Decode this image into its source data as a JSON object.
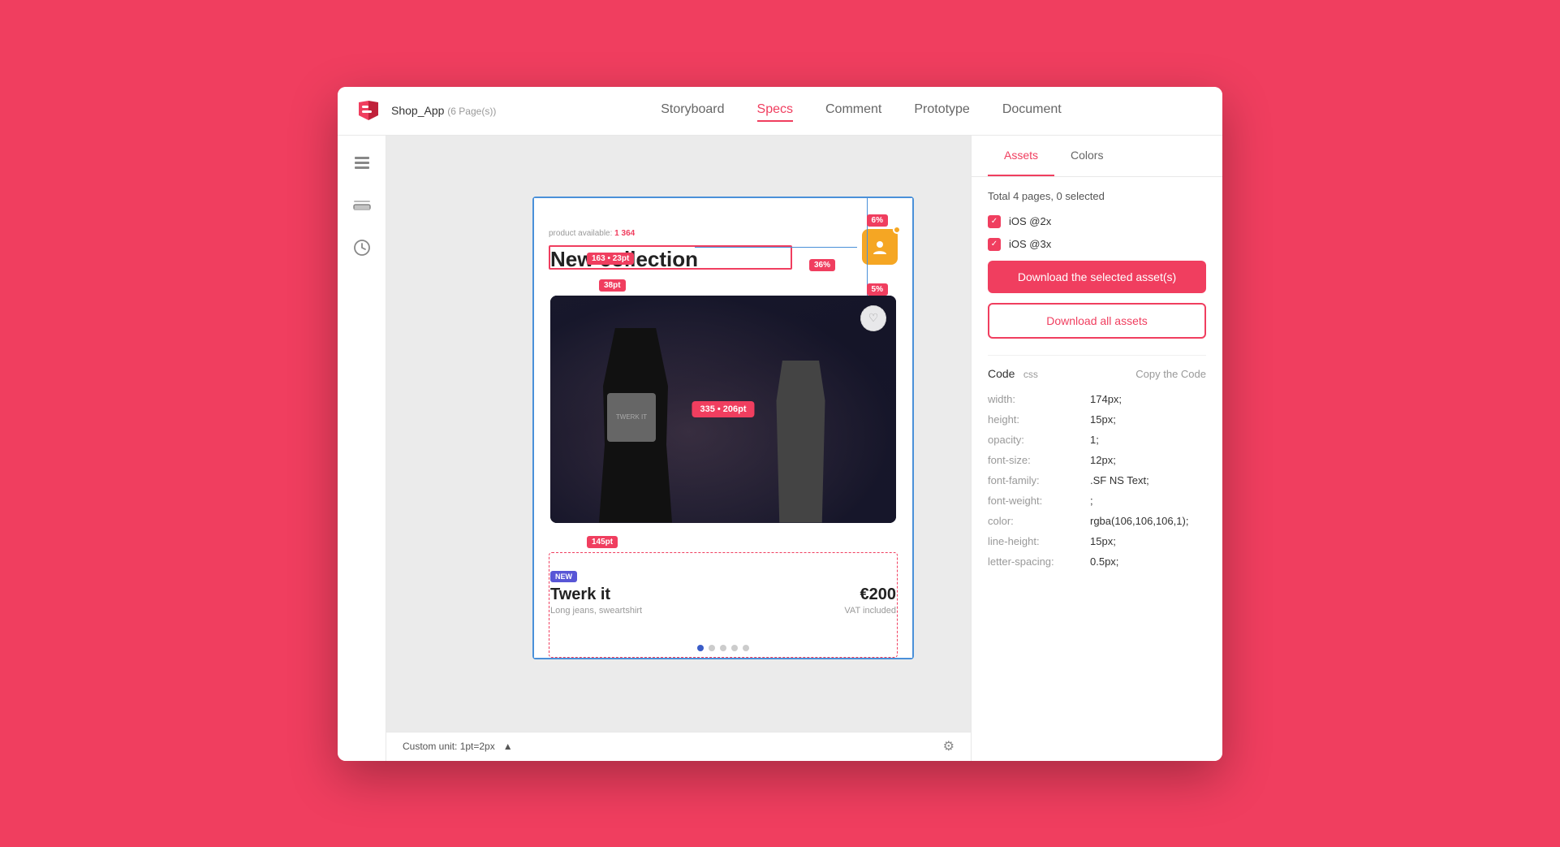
{
  "window": {
    "title": "Shop_App",
    "subtitle": "(6 Page(s))"
  },
  "header": {
    "nav": [
      {
        "id": "storyboard",
        "label": "Storyboard",
        "active": false
      },
      {
        "id": "specs",
        "label": "Specs",
        "active": true
      },
      {
        "id": "comment",
        "label": "Comment",
        "active": false
      },
      {
        "id": "prototype",
        "label": "Prototype",
        "active": false
      },
      {
        "id": "document",
        "label": "Document",
        "active": false
      }
    ]
  },
  "canvas": {
    "product_label": "product available:",
    "product_count": "1 364",
    "product_title": "New collection",
    "badges": {
      "b6pct": "6%",
      "b36pct": "36%",
      "b38pt": "38pt",
      "b5pct": "5%",
      "b163x23": "163 • 23pt",
      "b145pt": "145pt",
      "b335x206": "335 • 206pt"
    },
    "product": {
      "new_badge": "NEW",
      "name": "Twerk it",
      "price": "€200",
      "description": "Long jeans, sweartshirt",
      "vat": "VAT included"
    }
  },
  "bottom_bar": {
    "unit_label": "Custom unit: 1pt=2px",
    "arrow": "▲"
  },
  "right_panel": {
    "tabs": [
      {
        "id": "assets",
        "label": "Assets",
        "active": true
      },
      {
        "id": "colors",
        "label": "Colors",
        "active": false
      }
    ],
    "total_pages": "Total 4 pages, 0 selected",
    "checkboxes": [
      {
        "id": "ios2x",
        "label": "iOS @2x",
        "checked": true
      },
      {
        "id": "ios3x",
        "label": "iOS @3x",
        "checked": true
      }
    ],
    "btn_download_selected": "Download the selected asset(s)",
    "btn_download_all": "Download all assets",
    "code": {
      "title": "Code",
      "lang": "css",
      "copy_label": "Copy the Code",
      "properties": [
        {
          "key": "width:",
          "value": "174px;"
        },
        {
          "key": "height:",
          "value": "15px;"
        },
        {
          "key": "opacity:",
          "value": "1;"
        },
        {
          "key": "font-size:",
          "value": "12px;"
        },
        {
          "key": "font-family:",
          "value": ".SF NS Text;"
        },
        {
          "key": "font-weight:",
          "value": ";"
        },
        {
          "key": "color:",
          "value": "rgba(106,106,106,1);"
        },
        {
          "key": "line-height:",
          "value": "15px;"
        },
        {
          "key": "letter-spacing:",
          "value": "0.5px;"
        }
      ]
    }
  },
  "colors": {
    "accent": "#f03e5f",
    "blue": "#3a5cc7",
    "orange": "#f5a623",
    "purple": "#5856d6"
  },
  "icons": {
    "layers": "⊟",
    "stacks": "◫",
    "history": "◷",
    "checkmark": "✓",
    "heart": "♡",
    "cart": "🛍",
    "settings": "⚙"
  }
}
